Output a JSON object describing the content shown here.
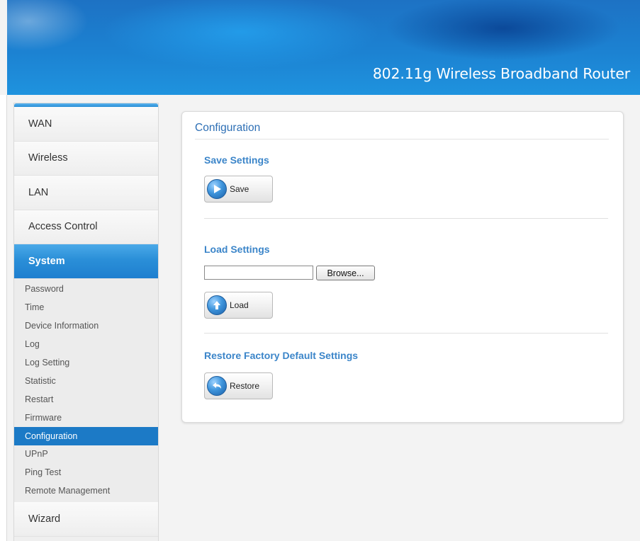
{
  "header": {
    "title": "802.11g Wireless Broadband Router"
  },
  "sidebar": {
    "top_items": [
      {
        "label": "WAN"
      },
      {
        "label": "Wireless"
      },
      {
        "label": "LAN"
      },
      {
        "label": "Access Control"
      }
    ],
    "active_section": {
      "label": "System"
    },
    "sub_items": [
      {
        "label": "Password"
      },
      {
        "label": "Time"
      },
      {
        "label": "Device Information"
      },
      {
        "label": "Log"
      },
      {
        "label": "Log Setting"
      },
      {
        "label": "Statistic"
      },
      {
        "label": "Restart"
      },
      {
        "label": "Firmware"
      },
      {
        "label": "Configuration",
        "selected": true
      },
      {
        "label": "UPnP"
      },
      {
        "label": "Ping Test"
      },
      {
        "label": "Remote Management"
      }
    ],
    "bottom_items": [
      {
        "label": "Wizard"
      }
    ]
  },
  "main": {
    "title": "Configuration",
    "save": {
      "heading": "Save Settings",
      "button_label": "Save",
      "icon": "play-arrow-icon"
    },
    "load": {
      "heading": "Load Settings",
      "file_value": "",
      "browse_label": "Browse...",
      "button_label": "Load",
      "icon": "upload-arrow-icon"
    },
    "restore": {
      "heading": "Restore Factory Default Settings",
      "button_label": "Restore",
      "icon": "undo-arrow-icon"
    }
  },
  "colors": {
    "accent": "#1c7ac6",
    "heading_blue": "#3b85c9",
    "banner_blue": "#1c82d2"
  }
}
